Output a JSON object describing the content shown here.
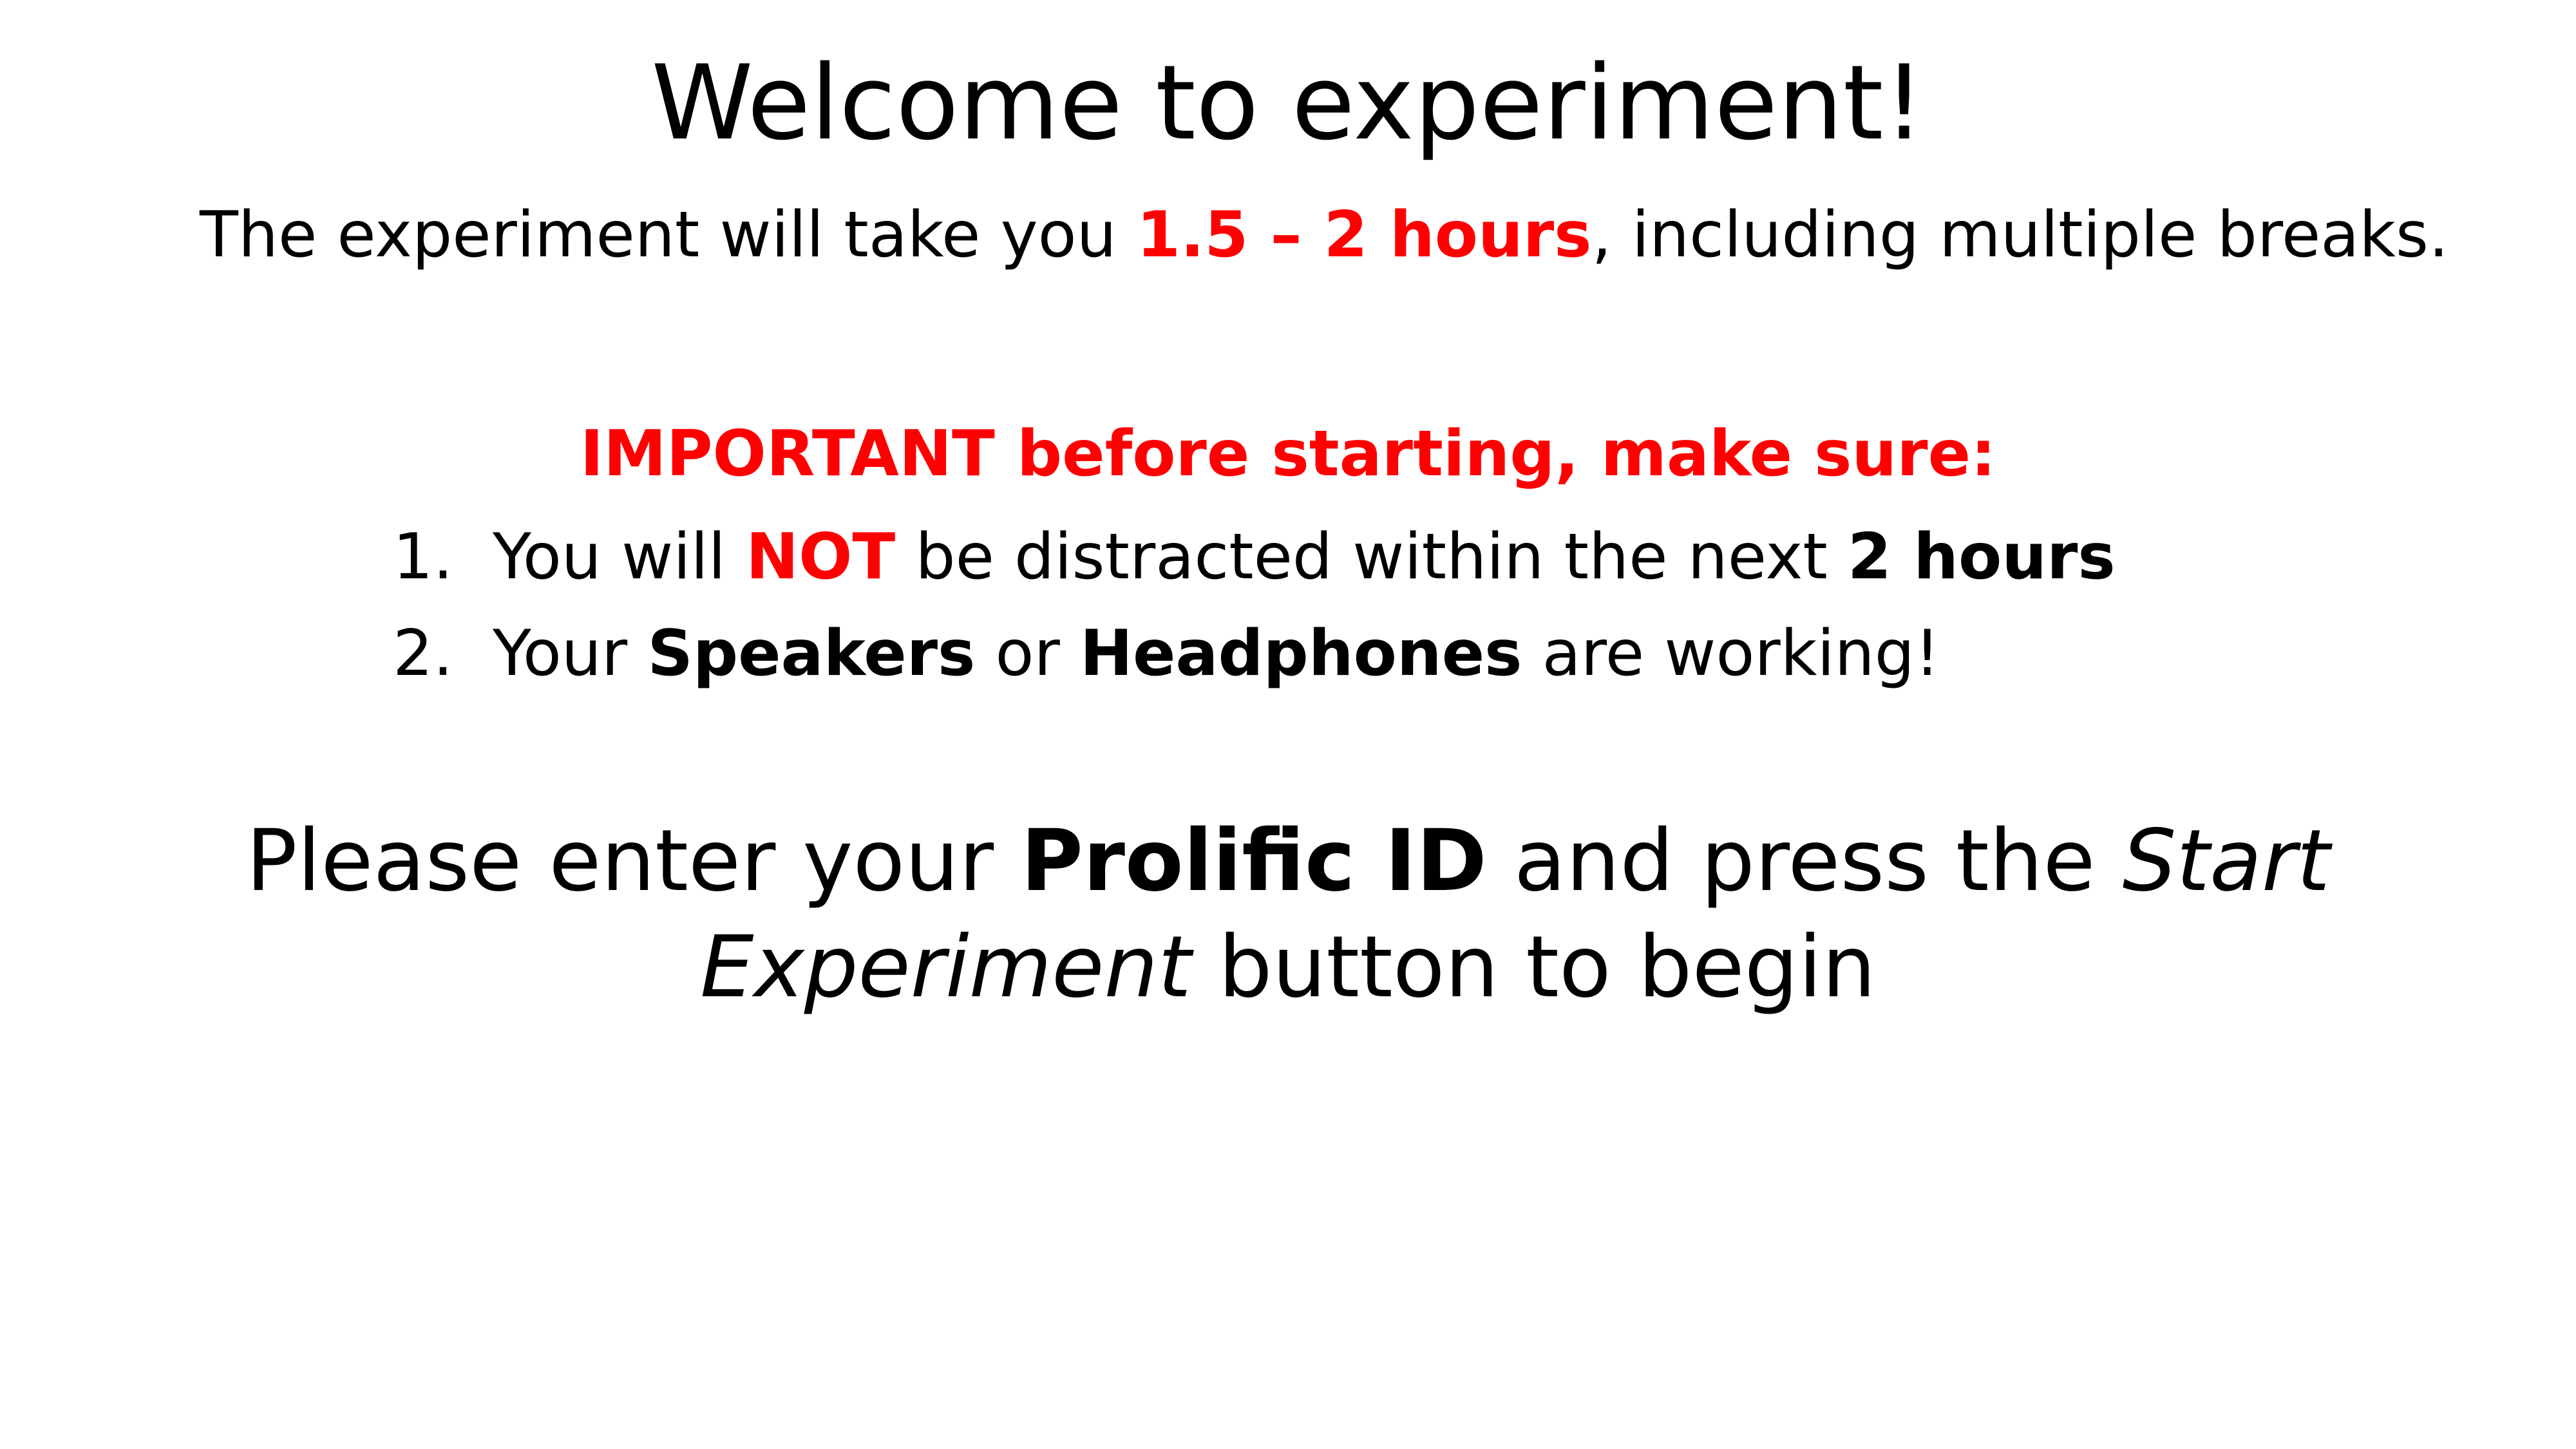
{
  "colors": {
    "accent": "#ff0000",
    "text": "#000000",
    "background": "#ffffff"
  },
  "title": "Welcome to experiment!",
  "intro": {
    "before": "The experiment will take you ",
    "duration": "1.5 – 2 hours",
    "after": ", including multiple breaks."
  },
  "important": {
    "heading": "IMPORTANT before starting, make sure:",
    "items": [
      {
        "number": "1.",
        "part1": "You will ",
        "emph": "NOT",
        "part2": " be distracted within the next ",
        "bold": "2 hours"
      },
      {
        "number": "2.",
        "part1": "Your ",
        "bold1": "Speakers",
        "part2": " or ",
        "bold2": "Headphones",
        "part3": " are working!"
      }
    ]
  },
  "instruction": {
    "part1": "Please enter your ",
    "bold": "Prolific ID",
    "part2": " and press the ",
    "italic1": "Start",
    "italic2": "Experiment",
    "part3": " button to begin"
  }
}
